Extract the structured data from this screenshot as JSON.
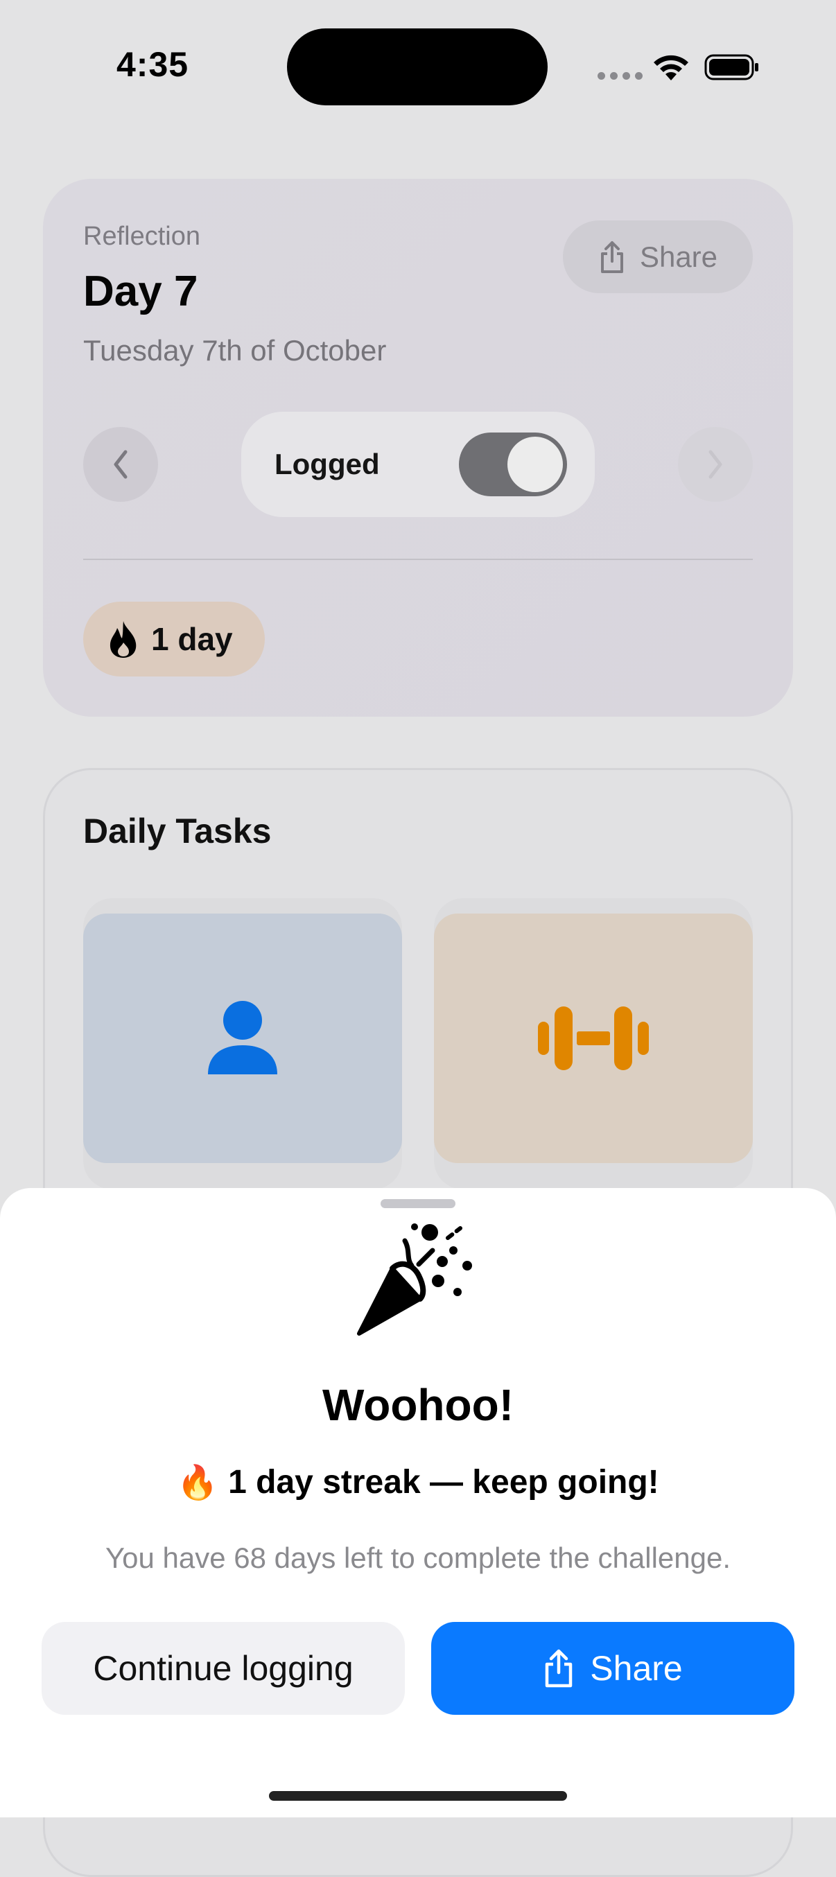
{
  "status_bar": {
    "time": "4:35",
    "icons": [
      "cellular-signal-icon",
      "wifi-icon",
      "battery-icon"
    ]
  },
  "reflection_card": {
    "eyebrow": "Reflection",
    "title": "Day 7",
    "date": "Tuesday 7th of October",
    "share_label": "Share",
    "logged_label": "Logged",
    "logged_on": true,
    "streak_badge": "1 day",
    "colors": {
      "card_bg": "#dad8df",
      "badge_bg": "#dccbbe"
    }
  },
  "daily_tasks": {
    "title": "Daily Tasks",
    "tiles": [
      {
        "icon": "person-icon",
        "color": "#0a6fe0"
      },
      {
        "icon": "dumbbell-icon",
        "color": "#e08600"
      }
    ]
  },
  "celebration_sheet": {
    "icon": "party-popper-icon",
    "headline": "Woohoo!",
    "streak_emoji": "🔥",
    "streak_text": "1 day streak — keep going!",
    "remaining_text": "You have 68 days left to complete the challenge.",
    "continue_label": "Continue logging",
    "share_label": "Share",
    "colors": {
      "primary": "#0a7aff",
      "secondary_bg": "#f1f1f4"
    }
  }
}
